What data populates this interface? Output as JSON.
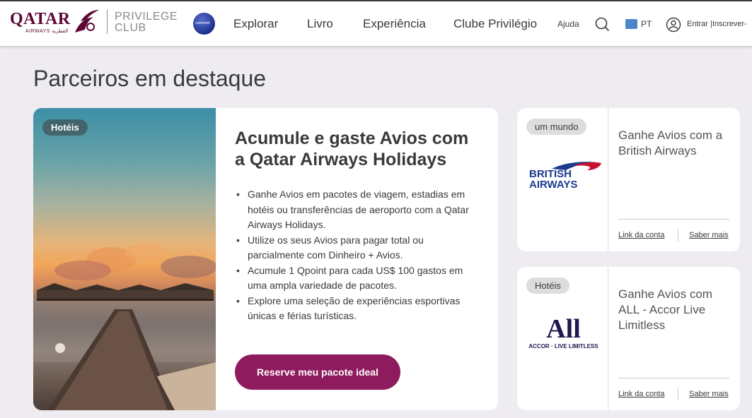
{
  "header": {
    "logo_word": "QATAR",
    "logo_sub": "AIRWAYS القطرية",
    "program_line1": "PRIVILEGE",
    "program_line2": "CLUB",
    "oneworld_label": "oneworld",
    "nav": [
      {
        "label": "Explorar"
      },
      {
        "label": "Livro"
      },
      {
        "label": "Experiência"
      },
      {
        "label": "Clube Privilégio"
      }
    ],
    "help": "Ajuda",
    "language": "PT",
    "login": "Entrar |Inscrever-"
  },
  "section_title": "Parceiros em destaque",
  "main_card": {
    "tag": "Hotéis",
    "title": "Acumule e gaste Avios com a Qatar Airways Holidays",
    "bullets": [
      "Ganhe Avios em pacotes de viagem, estadias em hotéis ou transferências de aeroporto com a Qatar Airways Holidays.",
      "Utilize os seus Avios para pagar total ou parcialmente com Dinheiro + Avios.",
      "Acumule 1 Qpoint para cada US$ 100 gastos em uma ampla variedade de pacotes.",
      "Explore uma seleção de experiências esportivas únicas e férias turísticas."
    ],
    "cta": "Reserve meu pacote ideal"
  },
  "side_cards": [
    {
      "tag": "um mundo",
      "logo_line1": "BRITISH",
      "logo_line2": "AIRWAYS",
      "title": "Ganhe Avios com a British Airways",
      "link_account": "Link da conta",
      "link_more": "Saber mais"
    },
    {
      "tag": "Hotéis",
      "logo_main": "All",
      "logo_sub": "ACCOR · LIVE LIMITLESS",
      "title": "Ganhe Avios com ALL - Accor Live Limitless",
      "link_account": "Link da conta",
      "link_more": "Saber mais"
    }
  ],
  "colors": {
    "brand": "#5c0632",
    "cta": "#8e1b5d",
    "background": "#eeecf0"
  }
}
